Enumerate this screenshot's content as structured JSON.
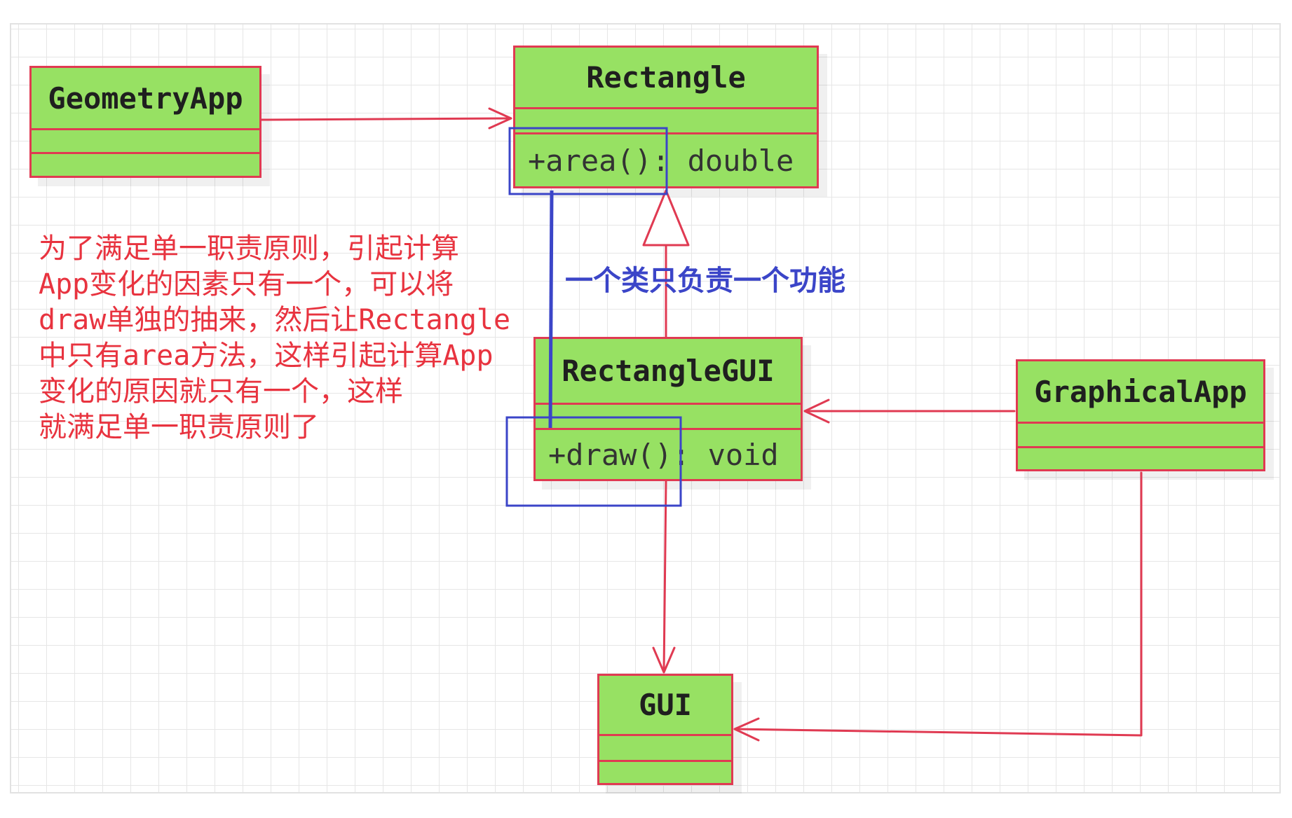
{
  "classes": {
    "geometry_app": {
      "name": "GeometryApp"
    },
    "rectangle": {
      "name": "Rectangle",
      "method": "+area(): double"
    },
    "rectangle_gui": {
      "name": "RectangleGUI",
      "method": "+draw(): void"
    },
    "graphical_app": {
      "name": "GraphicalApp"
    },
    "gui": {
      "name": "GUI"
    }
  },
  "annotations": {
    "srp_note": "一个类只负责一个功能",
    "explanation": [
      "为了满足单一职责原则，引起计算",
      "App变化的因素只有一个，可以将",
      "draw单独的抽来，然后让Rectangle",
      "中只有area方法，这样引起计算App",
      "变化的原因就只有一个，这样",
      "就满足单一职责原则了"
    ]
  },
  "colors": {
    "class_fill": "#97e163",
    "class_border": "#e03a52",
    "highlight": "#3b45c8",
    "note_text": "#e8333f"
  }
}
